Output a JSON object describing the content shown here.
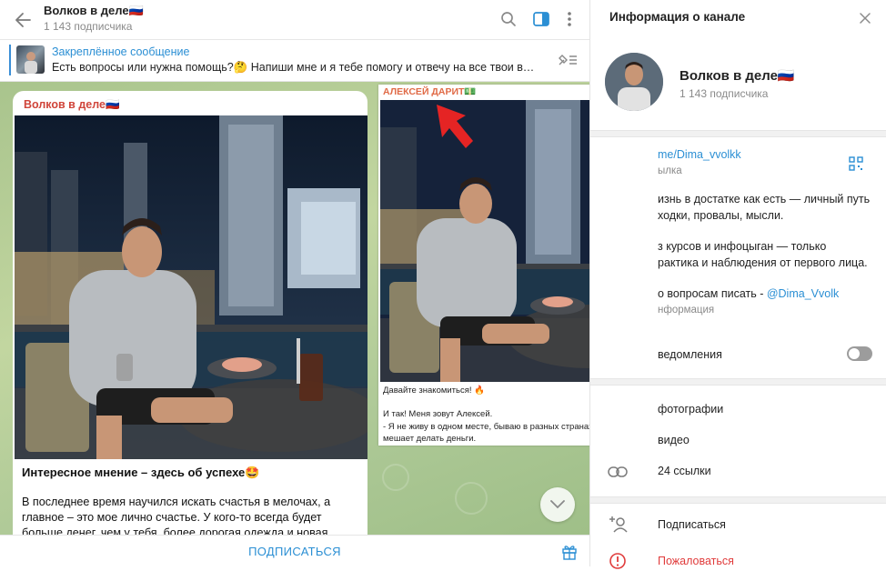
{
  "chat": {
    "title": "Волков в деле🇷🇺",
    "subscribers": "1 143 подписчика"
  },
  "pinned": {
    "title": "Закреплённое сообщение",
    "text": "Есть вопросы или нужна помощь?🤔  Напиши мне и я тебе помогу и отвечу на все твои воп..."
  },
  "message": {
    "author": "Волков в деле🇷🇺",
    "heading": "Интересное мнение – здесь об успехе🤩",
    "body": "В последнее время научился искать счастья в мелочах, а главное – это мое лично счастье. У кого-то всегда будет больше денег, чем у тебя, более дорогая одежда и новая тачка, но я хочу вам"
  },
  "overlay_post": {
    "author": "АЛЕКСЕЙ ДАРИТ💵",
    "line1": "Давайте знакомиться! 🔥",
    "line2": "И так! Меня зовут Алексей.",
    "line3": "- Я не живу в одном месте, бываю в разных странах и это мне не мешает делать деньги."
  },
  "bottom": {
    "subscribe_label": "ПОДПИСАТЬСЯ"
  },
  "info": {
    "header": "Информация о канале",
    "name": "Волков в деле🇷🇺",
    "subscribers": "1 143 подписчика",
    "link": "me/Dima_vvolkk",
    "link_sub": "ылка",
    "desc_line1": "изнь в достатке как есть — личный путь",
    "desc_line2": "ходки, провалы, мысли.",
    "desc_line3": "з курсов и инфоцыган — только",
    "desc_line4": "рактика и наблюдения от первого лица.",
    "desc_line5": "о вопросам писать - ",
    "desc_handle": "@Dima_Vvolk",
    "desc_sub": "нформация",
    "notifications": "ведомления",
    "photos": "фотографии",
    "videos": "видео",
    "links": "24 ссылки",
    "subscribe": "Подписаться",
    "report": "Пожаловаться"
  }
}
